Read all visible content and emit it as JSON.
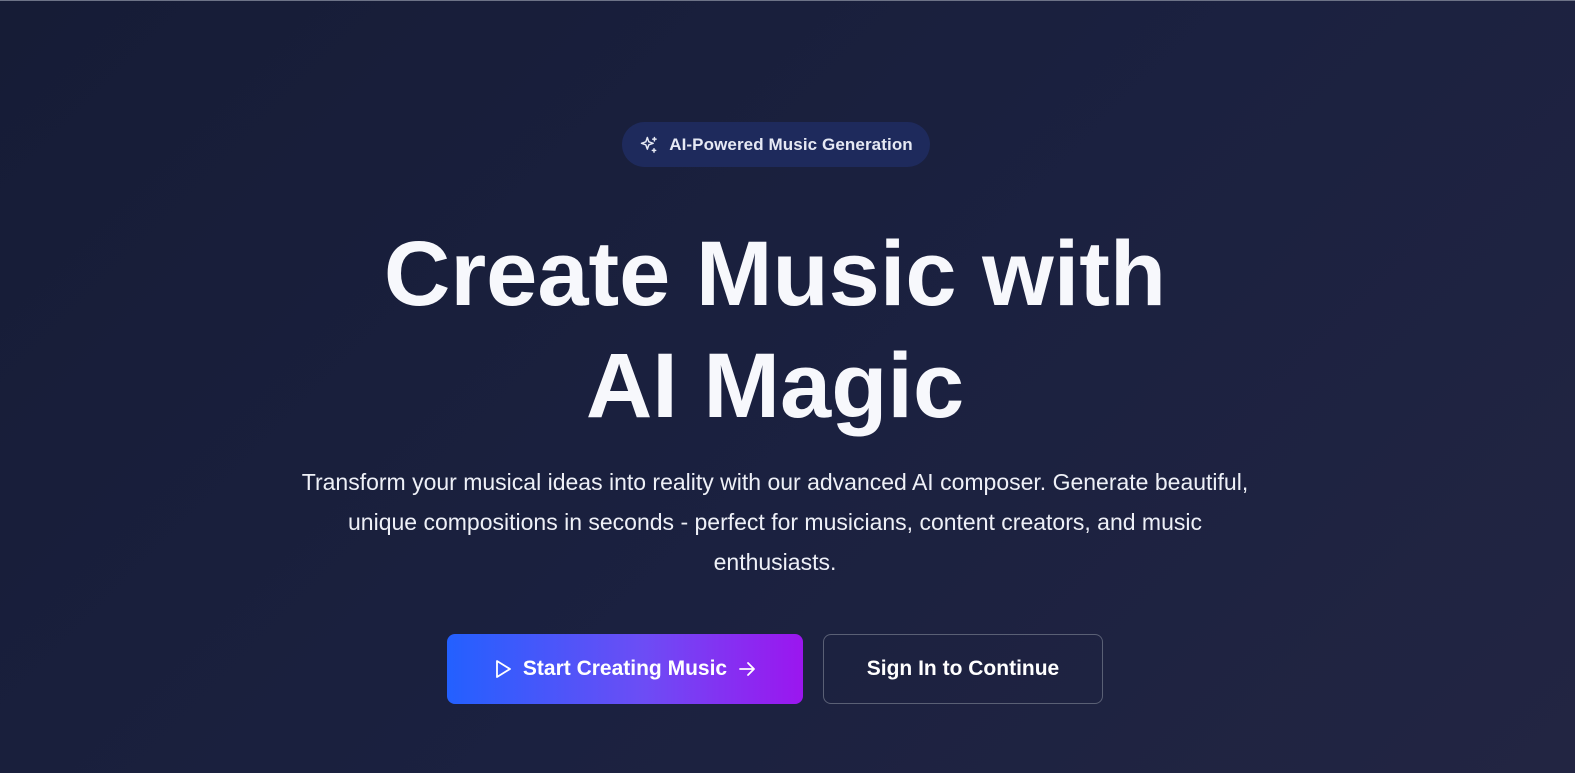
{
  "badge": {
    "label": "AI-Powered Music Generation",
    "icon": "sparkles-icon"
  },
  "hero": {
    "title_line1": "Create Music with",
    "title_line2": "AI Magic",
    "subtitle": "Transform your musical ideas into reality with our advanced AI composer. Generate beautiful, unique compositions in seconds - perfect for musicians, content creators, and music enthusiasts."
  },
  "actions": {
    "primary_label": "Start Creating Music",
    "primary_leading_icon": "play-icon",
    "primary_trailing_icon": "arrow-right-icon",
    "secondary_label": "Sign In to Continue"
  },
  "colors": {
    "background": "#1b2140",
    "badge_background": "#1e2a5c",
    "primary_gradient_start": "#2360ff",
    "primary_gradient_end": "#9b16ef",
    "secondary_border": "#5a6075",
    "text": "#f7f8fc"
  }
}
